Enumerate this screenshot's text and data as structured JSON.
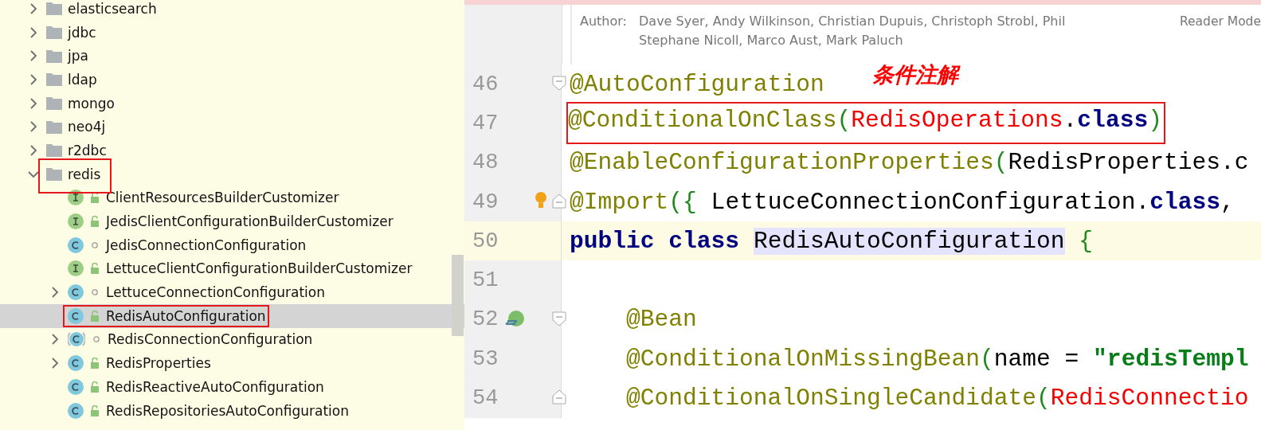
{
  "project_tree": {
    "items": [
      {
        "label": "elasticsearch",
        "kind": "folder",
        "expanded": false
      },
      {
        "label": "jdbc",
        "kind": "folder",
        "expanded": false
      },
      {
        "label": "jpa",
        "kind": "folder",
        "expanded": false
      },
      {
        "label": "ldap",
        "kind": "folder",
        "expanded": false
      },
      {
        "label": "mongo",
        "kind": "folder",
        "expanded": false
      },
      {
        "label": "neo4j",
        "kind": "folder",
        "expanded": false
      },
      {
        "label": "r2dbc",
        "kind": "folder",
        "expanded": false
      },
      {
        "label": "redis",
        "kind": "folder",
        "expanded": true,
        "boxed": true,
        "children": [
          {
            "label": "ClientResourcesBuilderCustomizer",
            "kind": "interface",
            "public": true,
            "selected": false
          },
          {
            "label": "JedisClientConfigurationBuilderCustomizer",
            "kind": "interface",
            "public": true,
            "selected": false
          },
          {
            "label": "JedisConnectionConfiguration",
            "kind": "class",
            "public": false,
            "selected": false
          },
          {
            "label": "LettuceClientConfigurationBuilderCustomizer",
            "kind": "interface",
            "public": true,
            "selected": false
          },
          {
            "label": "LettuceConnectionConfiguration",
            "kind": "class",
            "public": false,
            "expanded": false,
            "selected": false
          },
          {
            "label": "RedisAutoConfiguration",
            "kind": "class",
            "public": true,
            "selected": true,
            "boxed": true
          },
          {
            "label": "RedisConnectionConfiguration",
            "kind": "abstract",
            "public": false,
            "expanded": false,
            "selected": false
          },
          {
            "label": "RedisProperties",
            "kind": "class",
            "public": true,
            "expanded": false,
            "selected": false
          },
          {
            "label": "RedisReactiveAutoConfiguration",
            "kind": "class",
            "public": true,
            "selected": false
          },
          {
            "label": "RedisRepositoriesAutoConfiguration",
            "kind": "class",
            "public": true,
            "selected": false
          }
        ]
      }
    ]
  },
  "editor": {
    "doc": {
      "label": "Author:",
      "lines": [
        "Dave Syer, Andy Wilkinson, Christian Dupuis, Christoph Strobl, Phil",
        "Stephane Nicoll, Marco Aust, Mark Paluch"
      ],
      "reader_mode": "Reader Mode"
    },
    "note": "条件注解",
    "lines": [
      {
        "number": "46",
        "fold_open": true,
        "tokens": [
          {
            "kind": "annotation",
            "text": "@AutoConfiguration"
          }
        ]
      },
      {
        "number": "47",
        "boxed": true,
        "tokens": [
          {
            "kind": "annotation",
            "text": "@ConditionalOnClass"
          },
          {
            "kind": "paren",
            "text": "("
          },
          {
            "kind": "error",
            "text": "RedisOperations"
          },
          {
            "kind": "plain",
            "text": "."
          },
          {
            "kind": "keyword",
            "text": "class"
          },
          {
            "kind": "paren",
            "text": ")"
          }
        ]
      },
      {
        "number": "48",
        "tokens": [
          {
            "kind": "annotation",
            "text": "@EnableConfigurationProperties"
          },
          {
            "kind": "paren",
            "text": "("
          },
          {
            "kind": "plain",
            "text": "RedisProperties.c"
          }
        ]
      },
      {
        "number": "49",
        "fold_close": true,
        "bulb": true,
        "tokens": [
          {
            "kind": "annotation",
            "text": "@Import"
          },
          {
            "kind": "paren",
            "text": "({"
          },
          {
            "kind": "plain",
            "text": " LettuceConnectionConfiguration."
          },
          {
            "kind": "keyword",
            "text": "class"
          },
          {
            "kind": "plain",
            "text": ","
          }
        ]
      },
      {
        "number": "50",
        "current": true,
        "tokens": [
          {
            "kind": "keyword",
            "text": "public class "
          },
          {
            "kind": "usage",
            "text": "RedisAutoConfiguration"
          },
          {
            "kind": "paren",
            "text": " {"
          }
        ]
      },
      {
        "number": "51"
      },
      {
        "number": "52",
        "fold_open": true,
        "gutter_icon": true,
        "indented": true,
        "tokens": [
          {
            "kind": "annotation",
            "text": "@Bean"
          }
        ]
      },
      {
        "number": "53",
        "indented": true,
        "tokens": [
          {
            "kind": "annotation",
            "text": "@ConditionalOnMissingBean"
          },
          {
            "kind": "paren",
            "text": "("
          },
          {
            "kind": "plain",
            "text": "name = "
          },
          {
            "kind": "string",
            "text": "\"redisTempl"
          }
        ]
      },
      {
        "number": "54",
        "fold_close": true,
        "indented": true,
        "tokens": [
          {
            "kind": "annotation",
            "text": "@ConditionalOnSingleCandidate"
          },
          {
            "kind": "paren",
            "text": "("
          },
          {
            "kind": "error",
            "text": "RedisConnectio"
          }
        ]
      }
    ]
  }
}
